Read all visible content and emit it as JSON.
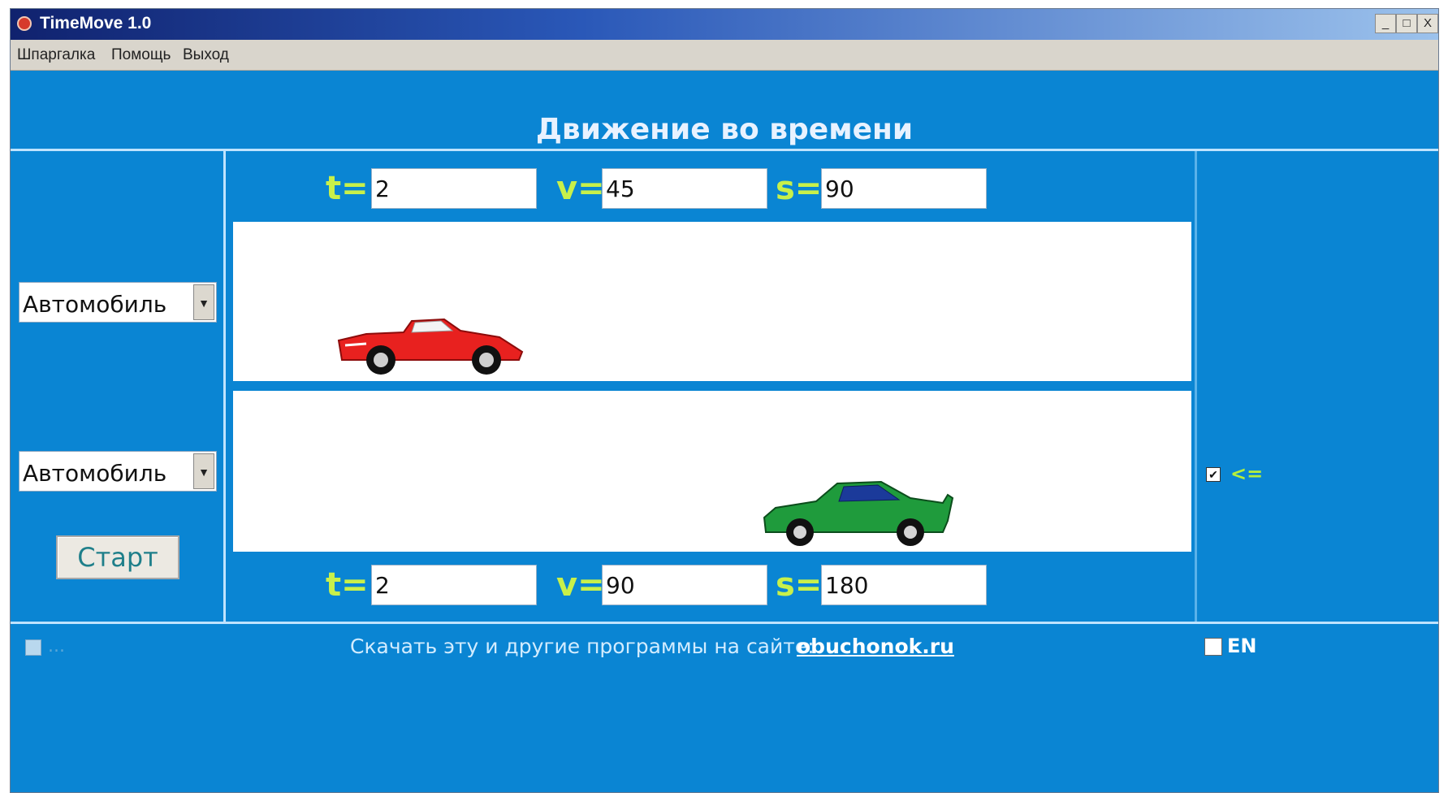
{
  "window": {
    "title": "TimeMove 1.0",
    "controls": [
      "_",
      "□",
      "X"
    ]
  },
  "menu": {
    "items": [
      "Шпаргалка",
      "Помощь",
      "Выход"
    ]
  },
  "header": {
    "title": "Движение во времени"
  },
  "top_params": {
    "t_label": "t=",
    "t_value": "2",
    "v_label": "v=",
    "v_value": "45",
    "s_label": "s=",
    "s_value": "90"
  },
  "bottom_params": {
    "t_label": "t=",
    "t_value": "2",
    "v_label": "v=",
    "v_value": "90",
    "s_label": "s=",
    "s_value": "180"
  },
  "vehicles": [
    {
      "selected": "Автомобиль",
      "car_color": "#e8211f"
    },
    {
      "selected": "Автомобиль",
      "car_color": "#1f9b3c"
    }
  ],
  "start_button": "Старт",
  "right_panel": {
    "checkbox_checked": true,
    "label": "<="
  },
  "footer": {
    "left_check_label": "...",
    "text": "Скачать эту и другие программы на сайте:",
    "link": "obuchonok.ru",
    "right_check_label": "EN"
  },
  "colors": {
    "background": "#0a85d3",
    "label_accent": "#c8f04a"
  }
}
